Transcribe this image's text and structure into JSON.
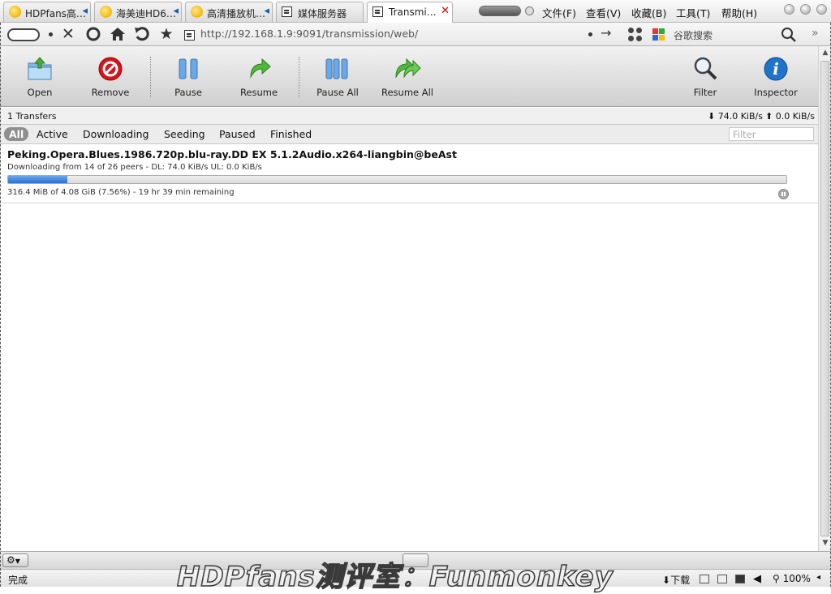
{
  "browser": {
    "tabs": [
      {
        "title": "HDPfans高…",
        "icon": "sun-icon"
      },
      {
        "title": "海美迪HD6…",
        "icon": "sun-icon"
      },
      {
        "title": "高清播放机…",
        "icon": "sun-icon"
      },
      {
        "title": "媒体服务器",
        "icon": "page-icon"
      },
      {
        "title": "Transmi…",
        "icon": "page-icon",
        "active": true
      }
    ],
    "menu": [
      "文件(F)",
      "查看(V)",
      "收藏(B)",
      "工具(T)",
      "帮助(H)"
    ],
    "url": "http://192.168.1.9:9091/transmission/web/",
    "search_engine_label": "谷歌搜索",
    "status_text": "完成",
    "download_label": "下载",
    "zoom": "100%"
  },
  "toolbar": {
    "open": "Open",
    "remove": "Remove",
    "pause": "Pause",
    "resume": "Resume",
    "pause_all": "Pause All",
    "resume_all": "Resume All",
    "filter": "Filter",
    "inspector": "Inspector"
  },
  "status": {
    "transfers": "1 Transfers",
    "download_rate": "74.0 KiB/s",
    "upload_rate": "0.0 KiB/s"
  },
  "filters": {
    "items": [
      "All",
      "Active",
      "Downloading",
      "Seeding",
      "Paused",
      "Finished"
    ],
    "selected": "All",
    "placeholder": "Filter"
  },
  "torrent": {
    "name": "Peking.Opera.Blues.1986.720p.blu-ray.DD EX 5.1.2Audio.x264-liangbin@beAst",
    "peers": "Downloading from 14 of 26 peers - DL: 74.0 KiB/s UL: 0.0 KiB/s",
    "progress_text": "316.4 MiB of 4.08 GiB (7.56%) - 19 hr 39 min remaining",
    "progress_fraction": 0.0756
  },
  "watermark": "HDPfans测评室：Funmonkey",
  "colors": {
    "progress": "#2d6ed1",
    "remove": "#d8141a",
    "inspector": "#1f74c9",
    "resume": "#3fa52b"
  }
}
